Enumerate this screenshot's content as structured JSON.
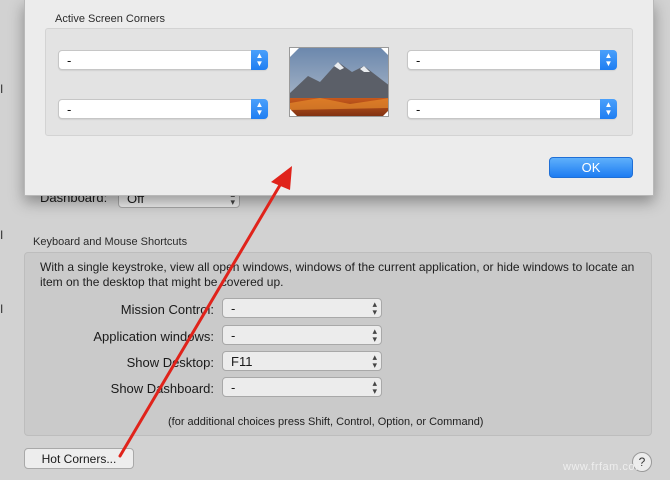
{
  "sheet": {
    "title": "Active Screen Corners",
    "corners": {
      "top_left": "-",
      "top_right": "-",
      "bottom_left": "-",
      "bottom_right": "-"
    },
    "ok_label": "OK"
  },
  "background": {
    "dashboard_label": "Dashboard:",
    "dashboard_value": "Off",
    "keyboard_group_title": "Keyboard and Mouse Shortcuts",
    "description": "With a single keystroke, view all open windows, windows of the current application, or hide windows to locate an item on the desktop that might be covered up.",
    "shortcuts": [
      {
        "label": "Mission Control:",
        "value": "-"
      },
      {
        "label": "Application windows:",
        "value": "-"
      },
      {
        "label": "Show Desktop:",
        "value": "F11"
      },
      {
        "label": "Show Dashboard:",
        "value": "-"
      }
    ],
    "hint": "(for additional choices press Shift, Control, Option, or Command)",
    "hot_corners_label": "Hot Corners...",
    "help_label": "?",
    "watermark": "www.frfam.com"
  },
  "colors": {
    "accent": "#1d7cf2",
    "annotation_arrow": "#e0231b"
  }
}
